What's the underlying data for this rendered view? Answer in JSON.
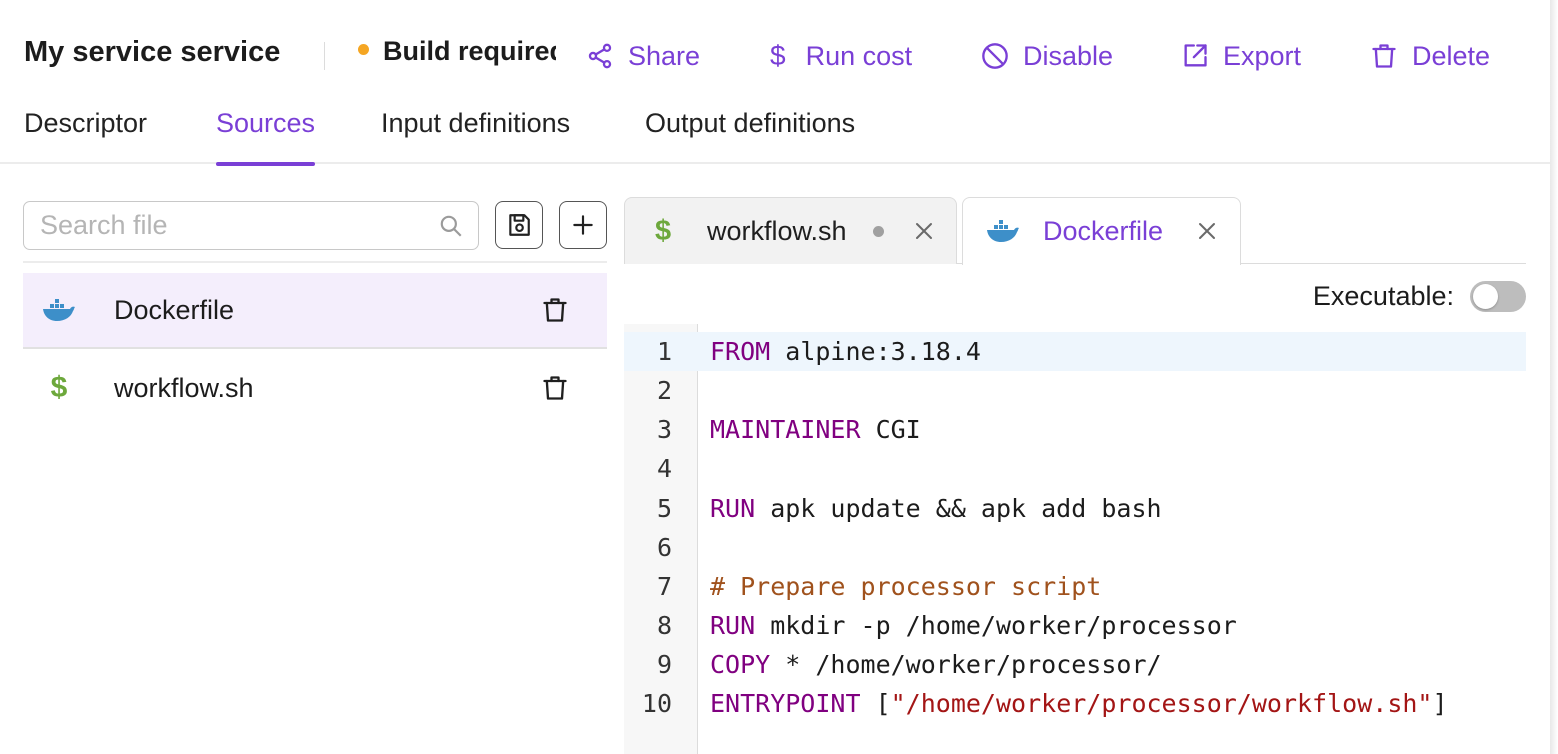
{
  "header": {
    "title": "My service service",
    "status": "Build required",
    "actions": [
      {
        "label": "Share",
        "icon": "share-icon"
      },
      {
        "label": "Run cost",
        "icon": "dollar-icon"
      },
      {
        "label": "Disable",
        "icon": "disable-icon"
      },
      {
        "label": "Export",
        "icon": "export-icon"
      },
      {
        "label": "Delete",
        "icon": "trash-icon"
      }
    ]
  },
  "tabs": [
    {
      "label": "Descriptor",
      "active": false
    },
    {
      "label": "Sources",
      "active": true
    },
    {
      "label": "Input definitions",
      "active": false
    },
    {
      "label": "Output definitions",
      "active": false
    }
  ],
  "sidebar": {
    "search_placeholder": "Search file",
    "files": [
      {
        "name": "Dockerfile",
        "icon": "docker-icon",
        "selected": true
      },
      {
        "name": "workflow.sh",
        "icon": "dollar-icon",
        "selected": false
      }
    ]
  },
  "editor": {
    "tabs": [
      {
        "label": "workflow.sh",
        "icon": "dollar-icon",
        "modified": true,
        "active": false
      },
      {
        "label": "Dockerfile",
        "icon": "docker-icon",
        "modified": false,
        "active": true
      }
    ],
    "executable_label": "Executable:",
    "executable": false,
    "lines": [
      {
        "num": "1",
        "kw": "FROM",
        "rest": " alpine:3.18.4"
      },
      {
        "num": "2",
        "kw": "",
        "rest": ""
      },
      {
        "num": "3",
        "kw": "MAINTAINER",
        "rest": " CGI"
      },
      {
        "num": "4",
        "kw": "",
        "rest": ""
      },
      {
        "num": "5",
        "kw": "RUN",
        "rest": " apk update && apk add bash"
      },
      {
        "num": "6",
        "kw": "",
        "rest": ""
      },
      {
        "num": "7",
        "comment": "# Prepare processor script"
      },
      {
        "num": "8",
        "kw": "RUN",
        "rest": " mkdir -p /home/worker/processor"
      },
      {
        "num": "9",
        "kw": "COPY",
        "rest": " * /home/worker/processor/"
      },
      {
        "num": "10",
        "kw": "ENTRYPOINT",
        "rest": " [",
        "str": "\"/home/worker/processor/workflow.sh\"",
        "tail": "]"
      }
    ]
  },
  "colors": {
    "accent": "#7a3fd6",
    "status_dot": "#f5a623",
    "shell_icon": "#6da83c",
    "docker_icon": "#3d8fc9"
  }
}
